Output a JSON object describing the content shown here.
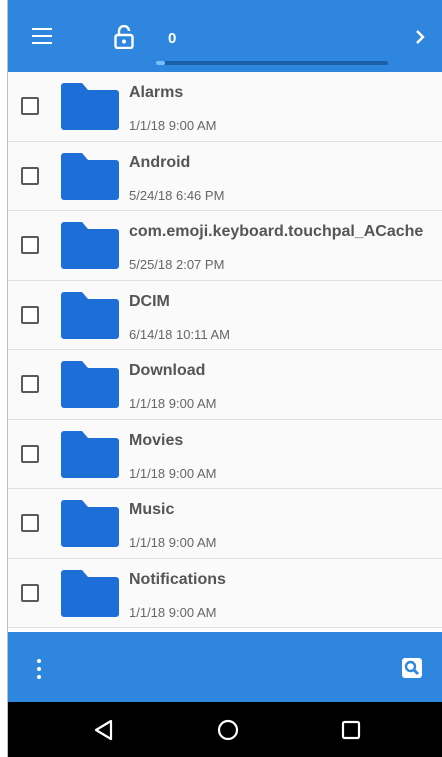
{
  "header": {
    "menu_icon": "hamburger-menu-icon",
    "lock_icon": "lock-open-icon",
    "selected_count": "0",
    "progress_fraction": 0.04,
    "next_icon": "chevron-right-icon"
  },
  "colors": {
    "primary": "#2f86df",
    "folder": "#1d6ed6",
    "nav_bar": "#000000"
  },
  "files": [
    {
      "name": "Alarms",
      "date": "1/1/18 9:00 AM"
    },
    {
      "name": "Android",
      "date": "5/24/18 6:46 PM"
    },
    {
      "name": "com.emoji.keyboard.touchpal_ACache",
      "date": "5/25/18 2:07 PM"
    },
    {
      "name": "DCIM",
      "date": "6/14/18 10:11 AM"
    },
    {
      "name": "Download",
      "date": "1/1/18 9:00 AM"
    },
    {
      "name": "Movies",
      "date": "1/1/18 9:00 AM"
    },
    {
      "name": "Music",
      "date": "1/1/18 9:00 AM"
    },
    {
      "name": "Notifications",
      "date": "1/1/18 9:00 AM"
    }
  ],
  "bottom_bar": {
    "more_icon": "more-vertical-icon",
    "search_icon": "search-icon"
  },
  "nav": {
    "back_icon": "back-triangle-icon",
    "home_icon": "home-circle-icon",
    "recents_icon": "recents-square-icon"
  }
}
